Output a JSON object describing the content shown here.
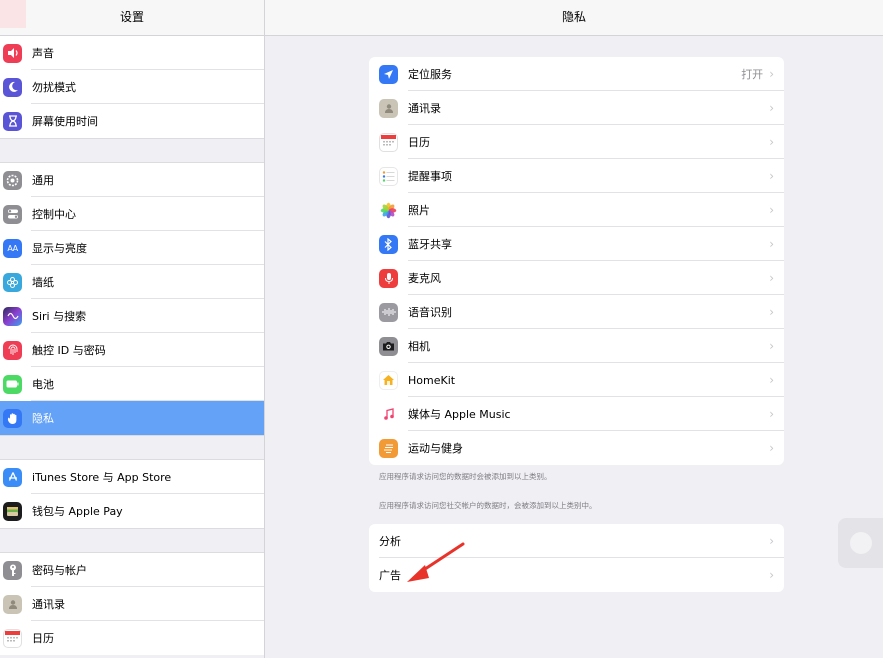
{
  "sidebar": {
    "title": "设置",
    "groups": [
      [
        {
          "label": "声音",
          "icon": "speaker-icon",
          "color": "#ee3d55"
        },
        {
          "label": "勿扰模式",
          "icon": "moon-icon",
          "color": "#5a55d6"
        },
        {
          "label": "屏幕使用时间",
          "icon": "hourglass-icon",
          "color": "#5a55d6"
        }
      ],
      [
        {
          "label": "通用",
          "icon": "gear-icon",
          "color": "#8e8e93"
        },
        {
          "label": "控制中心",
          "icon": "toggles-icon",
          "color": "#8e8e93"
        },
        {
          "label": "显示与亮度",
          "icon": "text-size-icon",
          "color": "#3478f6"
        },
        {
          "label": "墙纸",
          "icon": "flower-icon",
          "color": "#39a8dc"
        },
        {
          "label": "Siri 与搜索",
          "icon": "siri-icon",
          "color": "#2b2b58"
        },
        {
          "label": "触控 ID 与密码",
          "icon": "fingerprint-icon",
          "color": "#ee3d55"
        },
        {
          "label": "电池",
          "icon": "battery-icon",
          "color": "#4cd964"
        },
        {
          "label": "隐私",
          "icon": "hand-icon",
          "color": "#3478f6"
        }
      ],
      [
        {
          "label": "iTunes Store 与 App Store",
          "icon": "app-store-icon",
          "color": "#3a8df7"
        },
        {
          "label": "钱包与 Apple Pay",
          "icon": "wallet-icon",
          "color": "#1c1c1e"
        }
      ],
      [
        {
          "label": "密码与帐户",
          "icon": "key-icon",
          "color": "#8e8e93"
        },
        {
          "label": "通讯录",
          "icon": "contacts-icon",
          "color": "#c9c4b5"
        },
        {
          "label": "日历",
          "icon": "calendar-icon",
          "color": "#ffffff"
        }
      ]
    ]
  },
  "main": {
    "title": "隐私",
    "items": [
      {
        "label": "定位服务",
        "value": "打开",
        "icon": "location-arrow-icon",
        "color": "#3478f6"
      },
      {
        "label": "通讯录",
        "icon": "contacts-icon",
        "color": "#c9c4b5"
      },
      {
        "label": "日历",
        "icon": "calendar-icon",
        "color": "#ffffff"
      },
      {
        "label": "提醒事项",
        "icon": "reminders-icon",
        "color": "#ffffff"
      },
      {
        "label": "照片",
        "icon": "photos-icon",
        "color": "#ffffff"
      },
      {
        "label": "蓝牙共享",
        "icon": "bluetooth-icon",
        "color": "#3478f6"
      },
      {
        "label": "麦克风",
        "icon": "microphone-icon",
        "color": "#ee3d3d"
      },
      {
        "label": "语音识别",
        "icon": "waveform-icon",
        "color": "#9a9aa0"
      },
      {
        "label": "相机",
        "icon": "camera-icon",
        "color": "#8e8e93"
      },
      {
        "label": "HomeKit",
        "icon": "home-icon",
        "color": "#ffffff"
      },
      {
        "label": "媒体与 Apple Music",
        "icon": "music-note-icon",
        "color": "#ffffff"
      },
      {
        "label": "运动与健身",
        "icon": "motion-icon",
        "color": "#f29a36"
      }
    ],
    "footnote1": "应用程序请求访问您的数据时会被添加到以上类别。",
    "footnote2": "应用程序请求访问您社交帐户的数据时，会被添加到以上类别中。",
    "items2": [
      {
        "label": "分析"
      },
      {
        "label": "广告"
      }
    ]
  },
  "colors": {
    "selected": "#64a2f7",
    "arrow": "#e8332a"
  }
}
